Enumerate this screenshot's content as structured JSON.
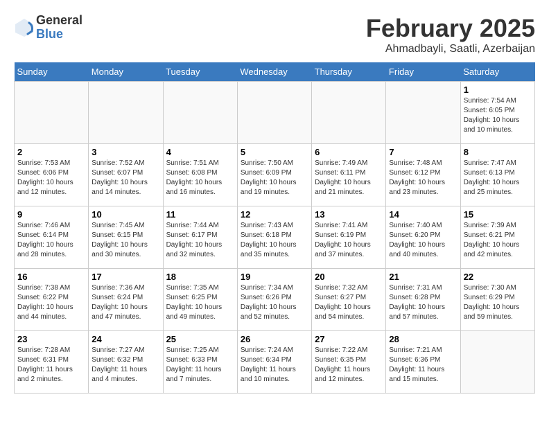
{
  "header": {
    "logo_general": "General",
    "logo_blue": "Blue",
    "month_title": "February 2025",
    "location": "Ahmadbayli, Saatli, Azerbaijan"
  },
  "days_of_week": [
    "Sunday",
    "Monday",
    "Tuesday",
    "Wednesday",
    "Thursday",
    "Friday",
    "Saturday"
  ],
  "weeks": [
    [
      {
        "day": "",
        "info": ""
      },
      {
        "day": "",
        "info": ""
      },
      {
        "day": "",
        "info": ""
      },
      {
        "day": "",
        "info": ""
      },
      {
        "day": "",
        "info": ""
      },
      {
        "day": "",
        "info": ""
      },
      {
        "day": "1",
        "info": "Sunrise: 7:54 AM\nSunset: 6:05 PM\nDaylight: 10 hours\nand 10 minutes."
      }
    ],
    [
      {
        "day": "2",
        "info": "Sunrise: 7:53 AM\nSunset: 6:06 PM\nDaylight: 10 hours\nand 12 minutes."
      },
      {
        "day": "3",
        "info": "Sunrise: 7:52 AM\nSunset: 6:07 PM\nDaylight: 10 hours\nand 14 minutes."
      },
      {
        "day": "4",
        "info": "Sunrise: 7:51 AM\nSunset: 6:08 PM\nDaylight: 10 hours\nand 16 minutes."
      },
      {
        "day": "5",
        "info": "Sunrise: 7:50 AM\nSunset: 6:09 PM\nDaylight: 10 hours\nand 19 minutes."
      },
      {
        "day": "6",
        "info": "Sunrise: 7:49 AM\nSunset: 6:11 PM\nDaylight: 10 hours\nand 21 minutes."
      },
      {
        "day": "7",
        "info": "Sunrise: 7:48 AM\nSunset: 6:12 PM\nDaylight: 10 hours\nand 23 minutes."
      },
      {
        "day": "8",
        "info": "Sunrise: 7:47 AM\nSunset: 6:13 PM\nDaylight: 10 hours\nand 25 minutes."
      }
    ],
    [
      {
        "day": "9",
        "info": "Sunrise: 7:46 AM\nSunset: 6:14 PM\nDaylight: 10 hours\nand 28 minutes."
      },
      {
        "day": "10",
        "info": "Sunrise: 7:45 AM\nSunset: 6:15 PM\nDaylight: 10 hours\nand 30 minutes."
      },
      {
        "day": "11",
        "info": "Sunrise: 7:44 AM\nSunset: 6:17 PM\nDaylight: 10 hours\nand 32 minutes."
      },
      {
        "day": "12",
        "info": "Sunrise: 7:43 AM\nSunset: 6:18 PM\nDaylight: 10 hours\nand 35 minutes."
      },
      {
        "day": "13",
        "info": "Sunrise: 7:41 AM\nSunset: 6:19 PM\nDaylight: 10 hours\nand 37 minutes."
      },
      {
        "day": "14",
        "info": "Sunrise: 7:40 AM\nSunset: 6:20 PM\nDaylight: 10 hours\nand 40 minutes."
      },
      {
        "day": "15",
        "info": "Sunrise: 7:39 AM\nSunset: 6:21 PM\nDaylight: 10 hours\nand 42 minutes."
      }
    ],
    [
      {
        "day": "16",
        "info": "Sunrise: 7:38 AM\nSunset: 6:22 PM\nDaylight: 10 hours\nand 44 minutes."
      },
      {
        "day": "17",
        "info": "Sunrise: 7:36 AM\nSunset: 6:24 PM\nDaylight: 10 hours\nand 47 minutes."
      },
      {
        "day": "18",
        "info": "Sunrise: 7:35 AM\nSunset: 6:25 PM\nDaylight: 10 hours\nand 49 minutes."
      },
      {
        "day": "19",
        "info": "Sunrise: 7:34 AM\nSunset: 6:26 PM\nDaylight: 10 hours\nand 52 minutes."
      },
      {
        "day": "20",
        "info": "Sunrise: 7:32 AM\nSunset: 6:27 PM\nDaylight: 10 hours\nand 54 minutes."
      },
      {
        "day": "21",
        "info": "Sunrise: 7:31 AM\nSunset: 6:28 PM\nDaylight: 10 hours\nand 57 minutes."
      },
      {
        "day": "22",
        "info": "Sunrise: 7:30 AM\nSunset: 6:29 PM\nDaylight: 10 hours\nand 59 minutes."
      }
    ],
    [
      {
        "day": "23",
        "info": "Sunrise: 7:28 AM\nSunset: 6:31 PM\nDaylight: 11 hours\nand 2 minutes."
      },
      {
        "day": "24",
        "info": "Sunrise: 7:27 AM\nSunset: 6:32 PM\nDaylight: 11 hours\nand 4 minutes."
      },
      {
        "day": "25",
        "info": "Sunrise: 7:25 AM\nSunset: 6:33 PM\nDaylight: 11 hours\nand 7 minutes."
      },
      {
        "day": "26",
        "info": "Sunrise: 7:24 AM\nSunset: 6:34 PM\nDaylight: 11 hours\nand 10 minutes."
      },
      {
        "day": "27",
        "info": "Sunrise: 7:22 AM\nSunset: 6:35 PM\nDaylight: 11 hours\nand 12 minutes."
      },
      {
        "day": "28",
        "info": "Sunrise: 7:21 AM\nSunset: 6:36 PM\nDaylight: 11 hours\nand 15 minutes."
      },
      {
        "day": "",
        "info": ""
      }
    ]
  ]
}
